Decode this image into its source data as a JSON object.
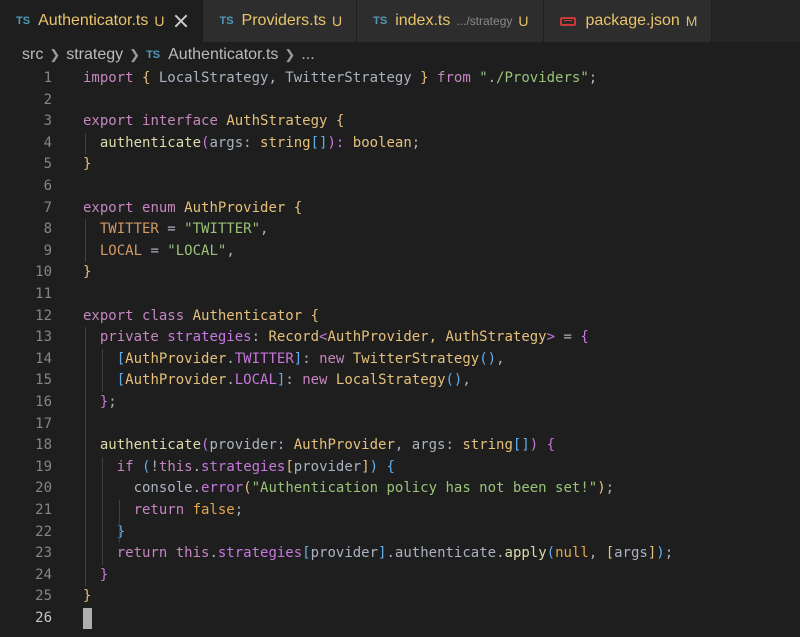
{
  "tabs": [
    {
      "icon": "TS",
      "name": "Authenticator.ts",
      "path": "",
      "status": "U",
      "active": true,
      "closable": true
    },
    {
      "icon": "TS",
      "name": "Providers.ts",
      "path": "",
      "status": "U",
      "active": false,
      "closable": false
    },
    {
      "icon": "TS",
      "name": "index.ts",
      "path": ".../strategy",
      "status": "U",
      "active": false,
      "closable": false
    },
    {
      "icon": "npm",
      "name": "package.json",
      "path": "",
      "status": "M",
      "active": false,
      "closable": false
    }
  ],
  "breadcrumb": {
    "folder1": "src",
    "folder2": "strategy",
    "file_icon": "TS",
    "file": "Authenticator.ts",
    "more": "..."
  },
  "editor": {
    "current_line": 26,
    "lines": [
      [
        [
          "import ",
          "kw"
        ],
        [
          "{ ",
          "br1"
        ],
        [
          "LocalStrategy, TwitterStrategy ",
          "pl"
        ],
        [
          "} ",
          "br1"
        ],
        [
          "from ",
          "kw"
        ],
        [
          "\"./Providers\"",
          "st"
        ],
        [
          ";",
          "pl"
        ]
      ],
      [],
      [
        [
          "export ",
          "kw"
        ],
        [
          "interface ",
          "kw"
        ],
        [
          "AuthStrategy ",
          "ty"
        ],
        [
          "{",
          "br1"
        ]
      ],
      [
        [
          "  authenticate",
          "fn"
        ],
        [
          "(",
          "br2"
        ],
        [
          "args: ",
          "pl"
        ],
        [
          "string",
          "ty"
        ],
        [
          "[]",
          "br3"
        ],
        [
          "): ",
          "br2"
        ],
        [
          "boolean",
          "ty"
        ],
        [
          ";",
          "pl"
        ]
      ],
      [
        [
          "}",
          "br1"
        ]
      ],
      [],
      [
        [
          "export ",
          "kw"
        ],
        [
          "enum ",
          "kw"
        ],
        [
          "AuthProvider ",
          "ty"
        ],
        [
          "{",
          "br1"
        ]
      ],
      [
        [
          "  TWITTER ",
          "en"
        ],
        [
          "= ",
          "pl"
        ],
        [
          "\"TWITTER\"",
          "st"
        ],
        [
          ",",
          "pl"
        ]
      ],
      [
        [
          "  LOCAL ",
          "en"
        ],
        [
          "= ",
          "pl"
        ],
        [
          "\"LOCAL\"",
          "st"
        ],
        [
          ",",
          "pl"
        ]
      ],
      [
        [
          "}",
          "br1"
        ]
      ],
      [],
      [
        [
          "export ",
          "kw"
        ],
        [
          "class ",
          "kw"
        ],
        [
          "Authenticator ",
          "ty"
        ],
        [
          "{",
          "br1"
        ]
      ],
      [
        [
          "  private ",
          "kw"
        ],
        [
          "strategies",
          "pr"
        ],
        [
          ": ",
          "pl"
        ],
        [
          "Record",
          "ty"
        ],
        [
          "<",
          "br2"
        ],
        [
          "AuthProvider, AuthStrategy",
          "ty"
        ],
        [
          "> ",
          "br2"
        ],
        [
          "= ",
          "pl"
        ],
        [
          "{",
          "br2"
        ]
      ],
      [
        [
          "    [",
          "br3"
        ],
        [
          "AuthProvider",
          "ty"
        ],
        [
          ".",
          "pl"
        ],
        [
          "TWITTER",
          "pr"
        ],
        [
          "]",
          "br3"
        ],
        [
          ": ",
          "pl"
        ],
        [
          "new ",
          "kw"
        ],
        [
          "TwitterStrategy",
          "ty"
        ],
        [
          "()",
          "br3"
        ],
        [
          ",",
          "pl"
        ]
      ],
      [
        [
          "    [",
          "br3"
        ],
        [
          "AuthProvider",
          "ty"
        ],
        [
          ".",
          "pl"
        ],
        [
          "LOCAL",
          "pr"
        ],
        [
          "]",
          "br3"
        ],
        [
          ": ",
          "pl"
        ],
        [
          "new ",
          "kw"
        ],
        [
          "LocalStrategy",
          "ty"
        ],
        [
          "()",
          "br3"
        ],
        [
          ",",
          "pl"
        ]
      ],
      [
        [
          "  }",
          "br2"
        ],
        [
          ";",
          "pl"
        ]
      ],
      [],
      [
        [
          "  authenticate",
          "fn"
        ],
        [
          "(",
          "br2"
        ],
        [
          "provider: ",
          "pl"
        ],
        [
          "AuthProvider",
          "ty"
        ],
        [
          ", args: ",
          "pl"
        ],
        [
          "string",
          "ty"
        ],
        [
          "[]",
          "br3"
        ],
        [
          ") ",
          "br2"
        ],
        [
          "{",
          "br2"
        ]
      ],
      [
        [
          "    if ",
          "kw"
        ],
        [
          "(",
          "br3"
        ],
        [
          "!",
          "pl"
        ],
        [
          "this",
          "kw"
        ],
        [
          ".",
          "pl"
        ],
        [
          "strategies",
          "pr"
        ],
        [
          "[",
          "br1"
        ],
        [
          "provider",
          "pl"
        ],
        [
          "]",
          "br1"
        ],
        [
          ") ",
          "br3"
        ],
        [
          "{",
          "br3"
        ]
      ],
      [
        [
          "      console",
          "pl"
        ],
        [
          ".",
          "pl"
        ],
        [
          "error",
          "pr"
        ],
        [
          "(",
          "br1"
        ],
        [
          "\"Authentication policy has not been set!\"",
          "st"
        ],
        [
          ")",
          "br1"
        ],
        [
          ";",
          "pl"
        ]
      ],
      [
        [
          "      return ",
          "kw"
        ],
        [
          "false",
          "kb"
        ],
        [
          ";",
          "pl"
        ]
      ],
      [
        [
          "    }",
          "br3"
        ]
      ],
      [
        [
          "    return ",
          "kw"
        ],
        [
          "this",
          "kw"
        ],
        [
          ".",
          "pl"
        ],
        [
          "strategies",
          "pr"
        ],
        [
          "[",
          "br3"
        ],
        [
          "provider",
          "pl"
        ],
        [
          "]",
          "br3"
        ],
        [
          ".",
          "pl"
        ],
        [
          "authenticate",
          "pl"
        ],
        [
          ".",
          "pl"
        ],
        [
          "apply",
          "fn"
        ],
        [
          "(",
          "br3"
        ],
        [
          "null",
          "kb"
        ],
        [
          ", ",
          "pl"
        ],
        [
          "[",
          "br1"
        ],
        [
          "args",
          "pl"
        ],
        [
          "]",
          "br1"
        ],
        [
          ")",
          "br3"
        ],
        [
          ";",
          "pl"
        ]
      ],
      [
        [
          "  }",
          "br2"
        ]
      ],
      [
        [
          "}",
          "br1"
        ]
      ],
      []
    ]
  }
}
